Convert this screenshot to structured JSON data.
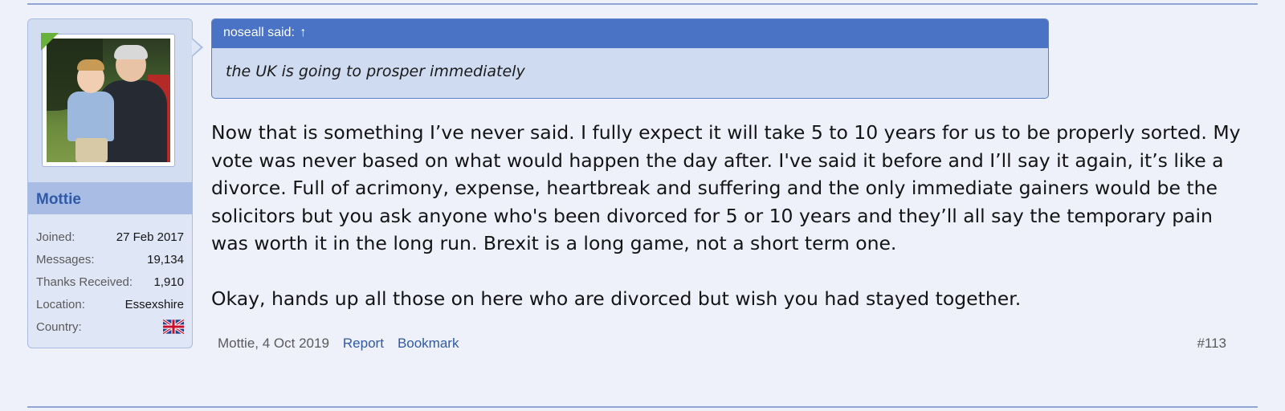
{
  "user": {
    "name": "Mottie",
    "avatar_icon": "user-avatar-photo",
    "stats": [
      {
        "label": "Joined:",
        "value": "27 Feb 2017"
      },
      {
        "label": "Messages:",
        "value": "19,134"
      },
      {
        "label": "Thanks Received:",
        "value": "1,910"
      },
      {
        "label": "Location:",
        "value": "Essexshire"
      },
      {
        "label": "Country:",
        "value": ""
      }
    ],
    "country_icon": "uk-flag-icon"
  },
  "quote": {
    "header": "noseall said:",
    "arrow": "↑",
    "text": "the UK is going to prosper immediately"
  },
  "message": {
    "paragraphs": [
      "Now that is something I’ve never said. I fully expect it will take 5 to 10 years for us to be properly sorted. My vote was never based on what would happen the day after. I've said it before and I’ll say it again, it’s like a divorce. Full of acrimony, expense, heartbreak and suffering and the only immediate gainers would be the solicitors but you ask anyone who's been divorced for 5 or 10 years and they’ll all say the temporary pain was worth it in the long run. Brexit is a long game, not a short term one.",
      "Okay, hands up all those on here who are divorced but wish you had stayed together."
    ]
  },
  "footer": {
    "author_date": "Mottie, 4 Oct 2019",
    "report": "Report",
    "bookmark": "Bookmark",
    "post_number": "#113"
  },
  "colors": {
    "accent": "#4a73c5",
    "link": "#2f5aa8",
    "panel": "#dfe6f5",
    "background": "#eef1fa"
  }
}
